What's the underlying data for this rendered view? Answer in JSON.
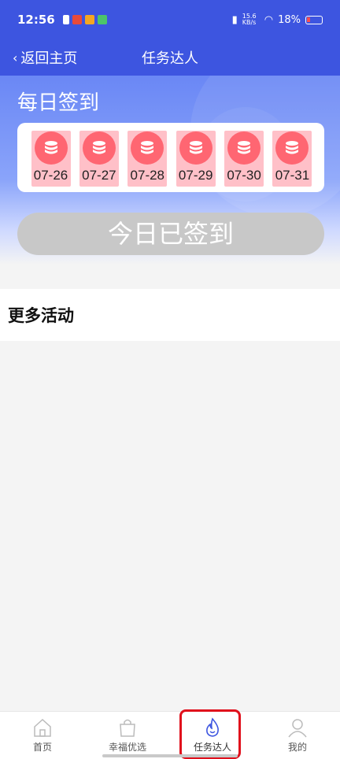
{
  "status_bar": {
    "time": "12:56",
    "net_speed": "15.6 KB/s",
    "battery": "18%"
  },
  "nav": {
    "back_label": "返回主页",
    "title": "任务达人"
  },
  "checkin": {
    "title": "每日签到",
    "days": [
      {
        "date": "07-26"
      },
      {
        "date": "07-27"
      },
      {
        "date": "07-28"
      },
      {
        "date": "07-29"
      },
      {
        "date": "07-30"
      },
      {
        "date": "07-31"
      }
    ],
    "button_label": "今日已签到"
  },
  "more": {
    "title": "更多活动"
  },
  "tabbar": {
    "tabs": [
      {
        "label": "首页",
        "icon": "home-icon"
      },
      {
        "label": "幸福优选",
        "icon": "shopping-bag-icon"
      },
      {
        "label": "任务达人",
        "icon": "flame-icon",
        "active": true
      },
      {
        "label": "我的",
        "icon": "user-icon"
      }
    ]
  },
  "colors": {
    "header": "#3d55e0",
    "coin": "#ff6672",
    "tile": "#ffc0c8",
    "highlight": "#e0101c"
  }
}
